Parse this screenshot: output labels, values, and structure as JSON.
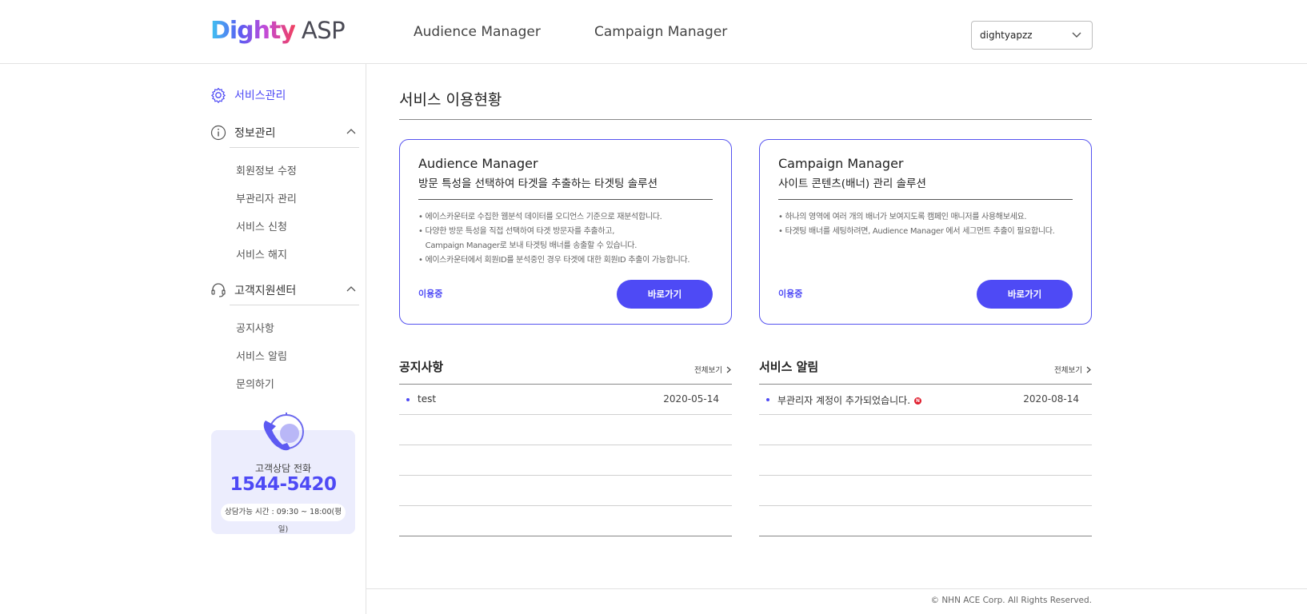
{
  "header": {
    "logo_brand": "Dighty",
    "logo_suffix": "ASP",
    "nav": [
      "Audience Manager",
      "Campaign Manager"
    ],
    "account_select": "dightyapzz"
  },
  "sidebar": {
    "service_admin": "서비스관리",
    "info_section": {
      "label": "정보관리",
      "items": [
        "회원정보 수정",
        "부관리자 관리",
        "서비스 신청",
        "서비스 해지"
      ]
    },
    "support_section": {
      "label": "고객지원센터",
      "items": [
        "공지사항",
        "서비스 알림",
        "문의하기"
      ]
    },
    "call_card": {
      "label": "고객상담 전화",
      "phone": "1544-5420",
      "hours": "상담가능 시간 : 09:30 ~ 18:00(평일)"
    }
  },
  "main": {
    "page_title": "서비스 이용현황",
    "cards": [
      {
        "name": "Audience Manager",
        "desc": "방문 특성을 선택하여 타겟을 추출하는 타겟팅 솔루션",
        "bullets": [
          "• 에이스카운터로 수집한 웹분석 데이터를 오디언스 기준으로 재분석합니다.",
          "• 다양한 방문 특성을 직접 선택하여 타겟 방문자를 추출하고,",
          "   Campaign Manager로 보내 타겟팅 배너를 송출할 수 있습니다.",
          "• 에이스카운터에서 회원ID를 분석중인 경우 타겟에 대한 회원ID 추출이 가능합니다."
        ],
        "status": "이용중",
        "button": "바로가기"
      },
      {
        "name": "Campaign Manager",
        "desc": "사이트 콘텐츠(배너) 관리 솔루션",
        "bullets": [
          "• 하나의 영역에 여러 개의 배너가 보여지도록 캠페인 매니저를 사용해보세요.",
          "• 타겟팅 배너를 세팅하려면, Audience Manager 에서 세그먼트 추출이 필요합니다."
        ],
        "status": "이용중",
        "button": "바로가기"
      }
    ],
    "boards": [
      {
        "title": "공지사항",
        "more": "전체보기",
        "rows": [
          {
            "text": "test",
            "date": "2020-05-14"
          }
        ]
      },
      {
        "title": "서비스 알림",
        "more": "전체보기",
        "rows": [
          {
            "text": "부관리자 계정이 추가되었습니다.",
            "date": "2020-08-14",
            "badge": "N"
          }
        ]
      }
    ]
  },
  "footer": {
    "copyright": "© NHN ACE Corp. All Rights Reserved."
  },
  "colors": {
    "accent": "#4e4af5",
    "callcard_bg": "#ecedfd",
    "new_badge": "#e01e2e"
  },
  "icons": [
    "gear-icon",
    "info-icon",
    "headset-icon",
    "chevron-up-icon",
    "chevron-down-icon",
    "chevron-right-icon",
    "phone-icon"
  ]
}
